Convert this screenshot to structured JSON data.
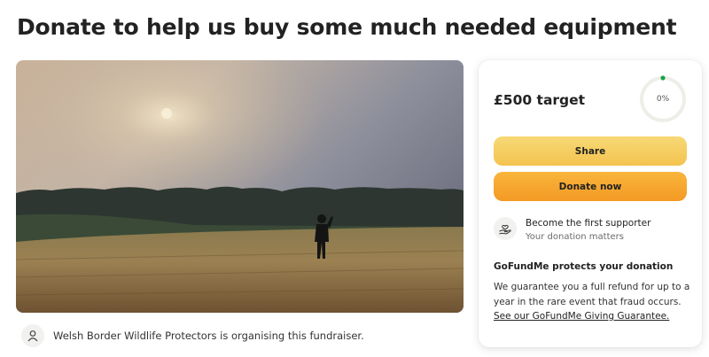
{
  "page": {
    "title": "Donate to help us buy some much needed equipment"
  },
  "organiser": {
    "text": "Welsh Border Wildlife Protectors is organising this fundraiser."
  },
  "donation_card": {
    "target": "£500 target",
    "progress_label": "0%",
    "progress_fraction": 0,
    "share_label": "Share",
    "donate_label": "Donate now",
    "supporter_title": "Become the first supporter",
    "supporter_subtitle": "Your donation matters",
    "protection_title": "GoFundMe protects your donation",
    "protection_text": "We guarantee you a full refund for up to a year in the rare event that fraud occurs.",
    "protection_link": "See our GoFundMe Giving Guarantee."
  },
  "colors": {
    "share_button": "#f3c34f",
    "donate_button": "#f39a24",
    "progress_dot": "#1ba34a"
  },
  "icons": {
    "organiser_avatar": "person-icon",
    "supporter": "hand-heart-icon"
  }
}
